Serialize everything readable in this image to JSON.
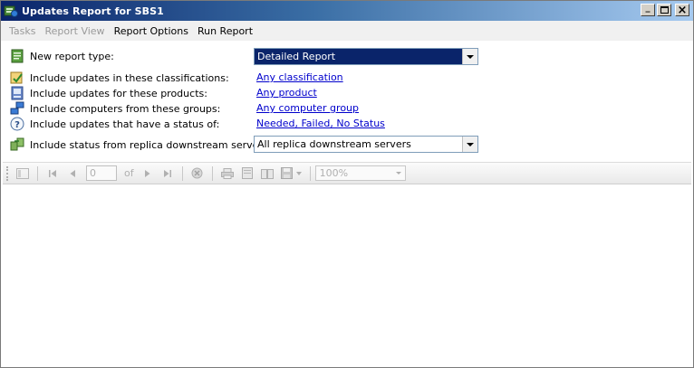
{
  "window": {
    "title": "Updates Report for SBS1",
    "controls": {
      "minimize": "_",
      "maximize": "□",
      "close": "×"
    }
  },
  "menu": {
    "items": [
      {
        "label": "Tasks",
        "enabled": false
      },
      {
        "label": "Report View",
        "enabled": false
      },
      {
        "label": "Report Options",
        "enabled": true
      },
      {
        "label": "Run Report",
        "enabled": true
      }
    ]
  },
  "options": {
    "report_type": {
      "label": "New report type:",
      "value": "Detailed Report",
      "icon": "report-icon"
    },
    "classifications": {
      "label": "Include updates in these classifications:",
      "value": "Any classification",
      "icon": "classification-icon"
    },
    "products": {
      "label": "Include updates for these products:",
      "value": "Any product",
      "icon": "product-icon"
    },
    "groups": {
      "label": "Include computers from these groups:",
      "value": "Any computer group",
      "icon": "computer-group-icon"
    },
    "status": {
      "label": "Include updates that have a status of:",
      "value": "Needed, Failed, No Status",
      "icon": "help-icon"
    },
    "replica": {
      "label": "Include status from replica downstream servers:",
      "value": "All replica downstream servers",
      "icon": "replica-servers-icon"
    }
  },
  "toolbar": {
    "page_value": "0",
    "of_label": "of",
    "zoom_value": "100%"
  },
  "colors": {
    "title_gradient_start": "#0a246a",
    "title_gradient_end": "#a6caf0",
    "link": "#0000cc",
    "selection": "#0a246a"
  }
}
